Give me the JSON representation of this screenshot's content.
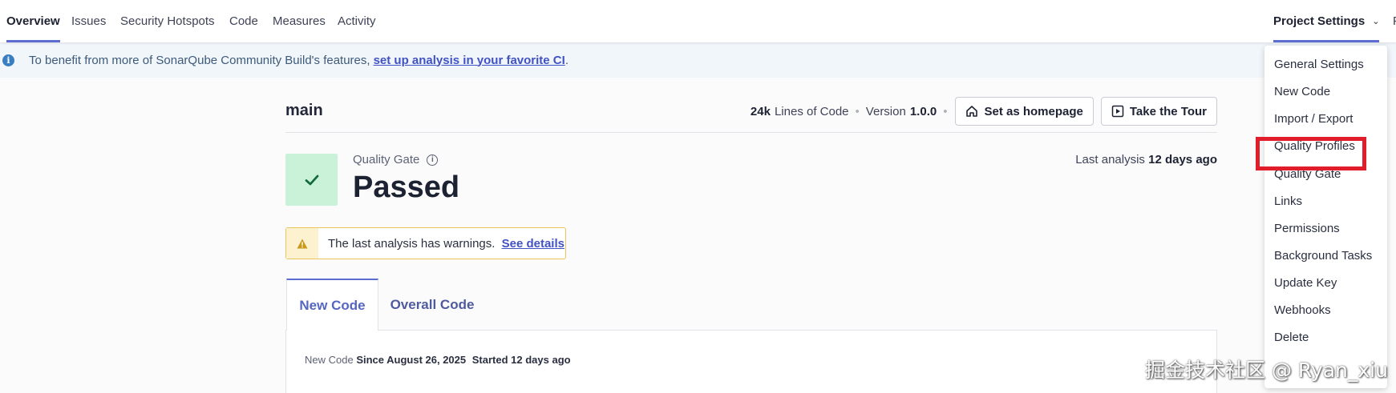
{
  "nav": {
    "tabs": [
      "Overview",
      "Issues",
      "Security Hotspots",
      "Code",
      "Measures",
      "Activity"
    ],
    "project_settings": "Project Settings",
    "cut_tab": "P"
  },
  "banner": {
    "text": "To benefit from more of SonarQube Community Build's features,",
    "link": "set up analysis in your favorite CI",
    "suffix": "."
  },
  "branch": "main",
  "meta": {
    "loc_value": "24k",
    "loc_label": "Lines of Code",
    "version_label": "Version",
    "version_value": "1.0.0",
    "set_homepage": "Set as homepage",
    "take_tour": "Take the Tour"
  },
  "quality_gate": {
    "label": "Quality Gate",
    "status": "Passed",
    "last_analysis_label": "Last analysis",
    "last_analysis_value": "12 days ago"
  },
  "warning": {
    "text": "The last analysis has warnings.",
    "link": "See details"
  },
  "code_tabs": [
    "New Code",
    "Overall Code"
  ],
  "since": {
    "label": "New Code",
    "since": "Since August 26, 2025",
    "started": "Started 12 days ago"
  },
  "dropdown": [
    "General Settings",
    "New Code",
    "Import / Export",
    "Quality Profiles",
    "Quality Gate",
    "Links",
    "Permissions",
    "Background Tasks",
    "Update Key",
    "Webhooks",
    "Delete"
  ],
  "watermark": "掘金技术社区 @ Ryan_xiu",
  "colors": {
    "accent": "#5d6cd0",
    "success_bg": "#c9f2d9",
    "success_check": "#146b3a",
    "warning_border": "#e9c35c",
    "highlight": "#e11d2b"
  }
}
